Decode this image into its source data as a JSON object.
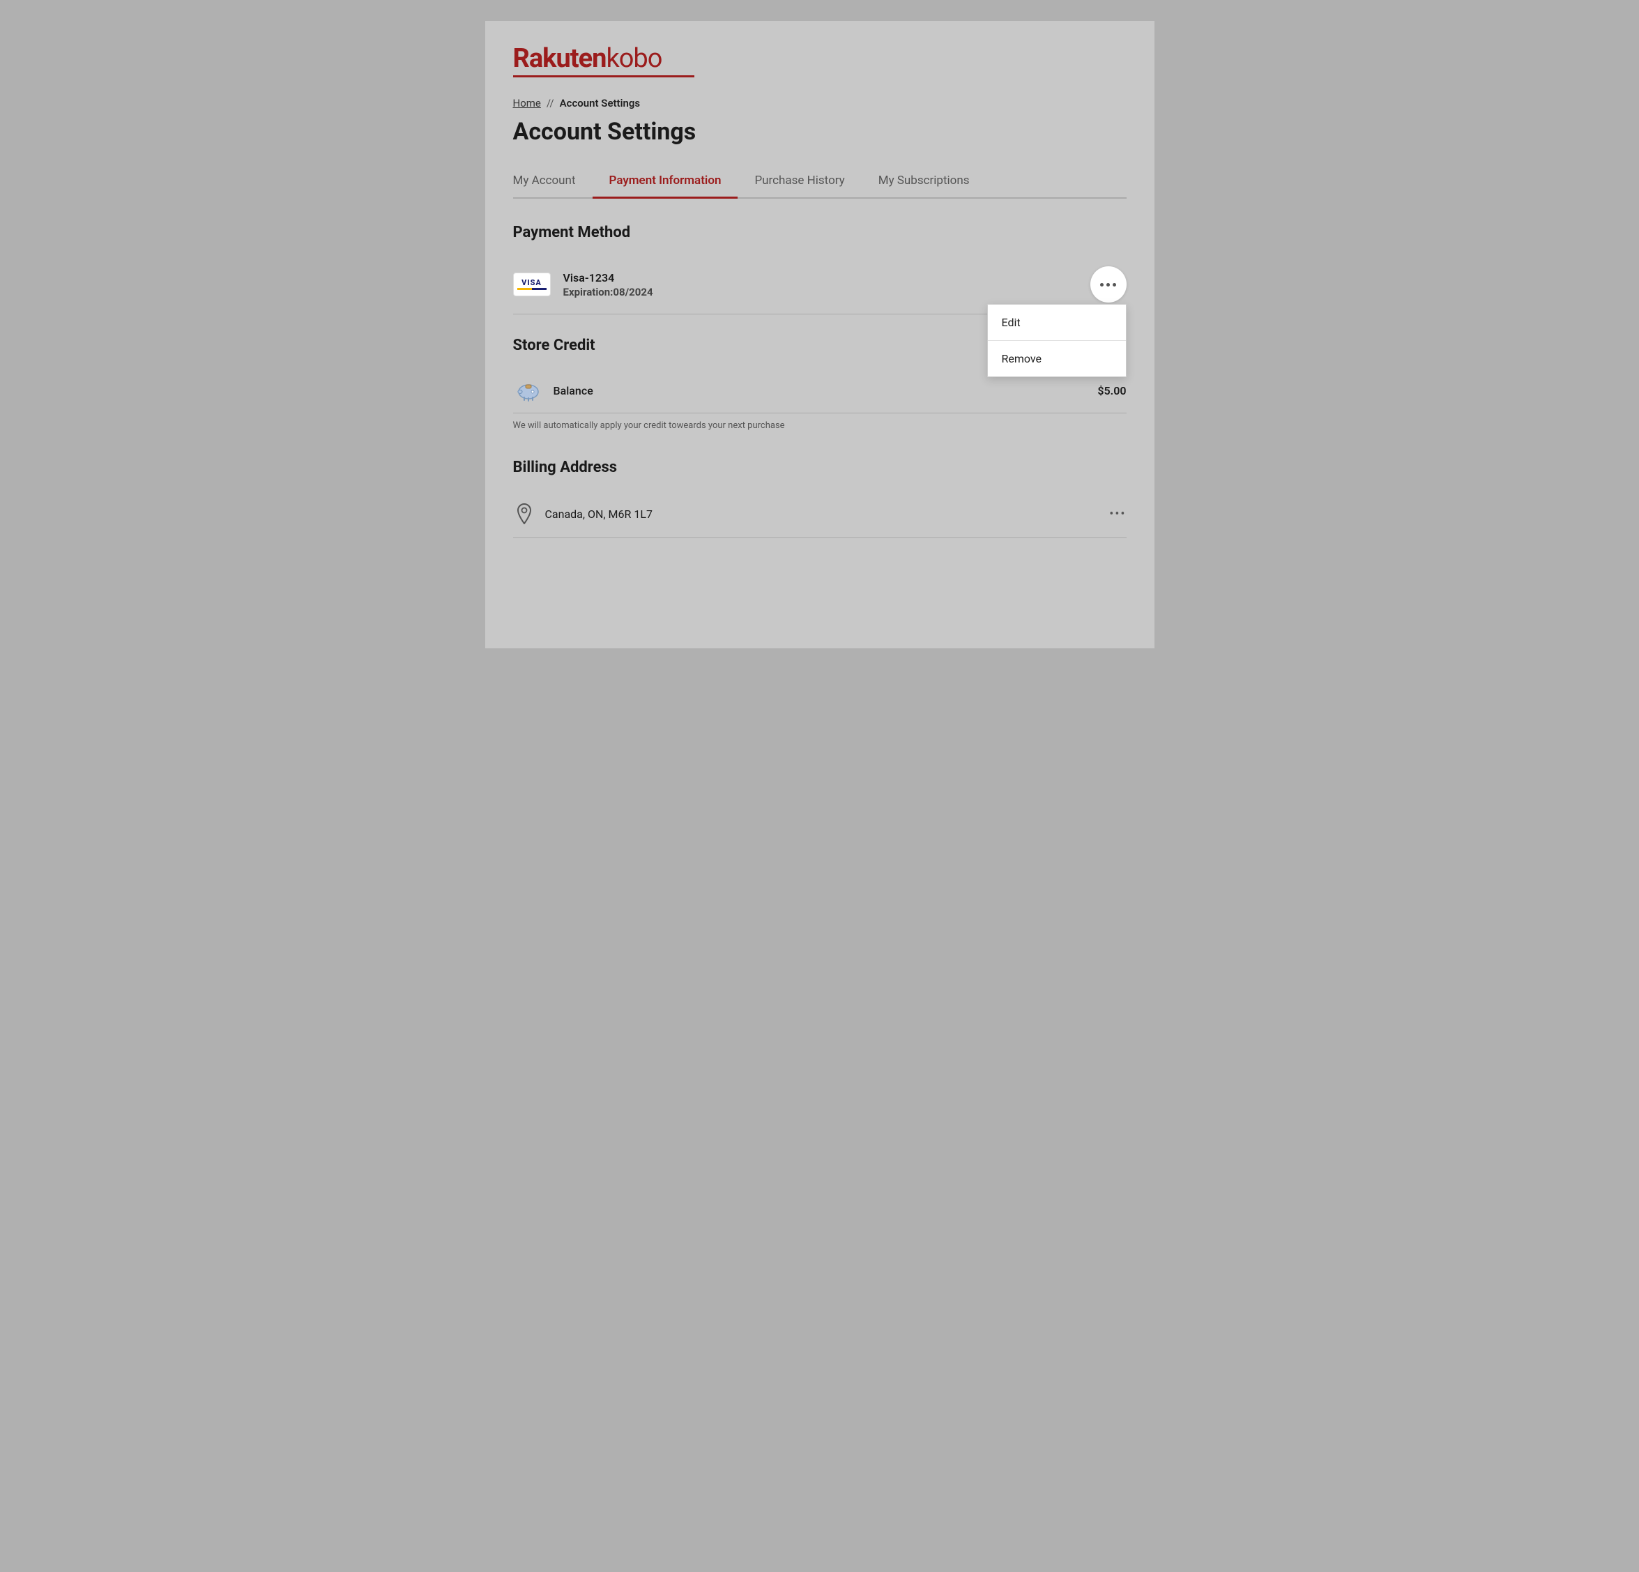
{
  "logo": {
    "brand": "Rakuten",
    "product": "kobo"
  },
  "breadcrumb": {
    "home": "Home",
    "separator": "//",
    "current": "Account Settings"
  },
  "page_title": "Account Settings",
  "tabs": [
    {
      "id": "my-account",
      "label": "My Account",
      "active": false
    },
    {
      "id": "payment-information",
      "label": "Payment Information",
      "active": true
    },
    {
      "id": "purchase-history",
      "label": "Purchase History",
      "active": false
    },
    {
      "id": "my-subscriptions",
      "label": "My Subscriptions",
      "active": false
    }
  ],
  "payment_method": {
    "section_title": "Payment Method",
    "card": {
      "brand": "VISA",
      "name": "Visa-1234",
      "expiry_label": "Expiration:",
      "expiry_value": "08/2024"
    },
    "dropdown": {
      "items": [
        {
          "id": "edit",
          "label": "Edit"
        },
        {
          "id": "remove",
          "label": "Remove"
        }
      ]
    }
  },
  "store_credit": {
    "section_title": "Store Credit",
    "balance_label": "Balance",
    "balance_amount": "$5.00",
    "note": "We will automatically apply your credit toweards your next purchase"
  },
  "billing_address": {
    "section_title": "Billing Address",
    "address": "Canada, ON, M6R 1L7"
  }
}
